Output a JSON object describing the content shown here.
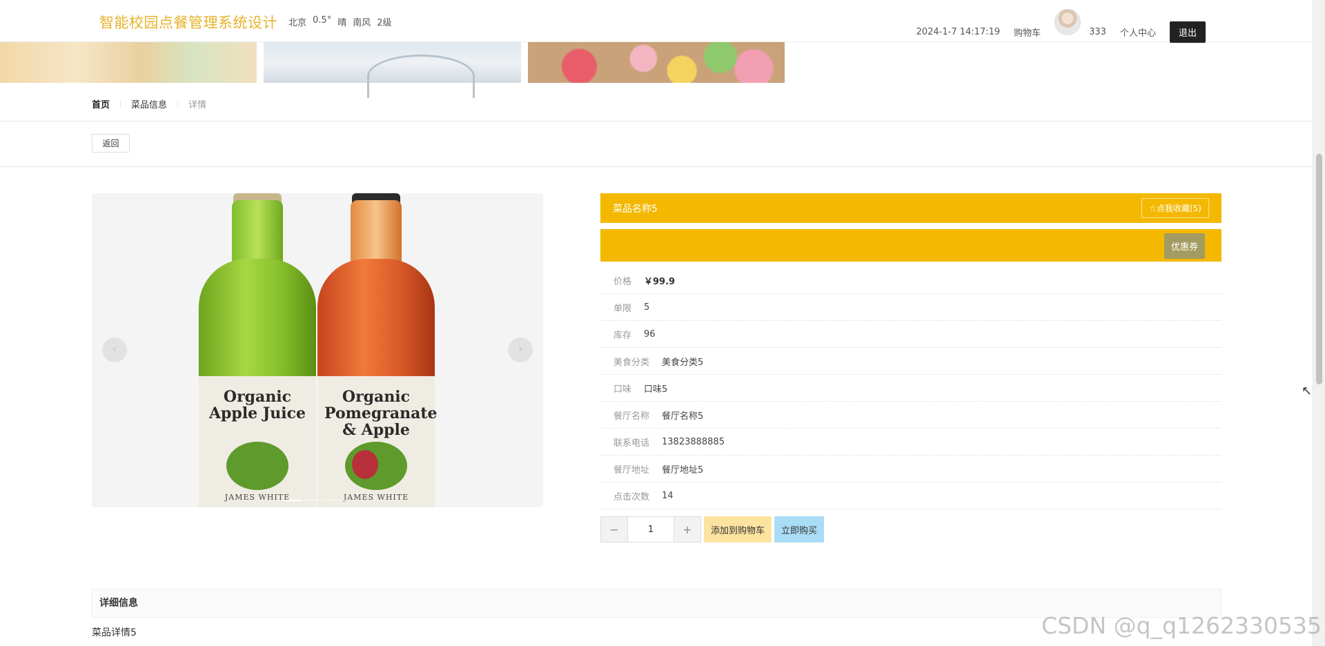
{
  "header": {
    "site_title": "智能校园点餐管理系统设计",
    "weather": {
      "city": "北京",
      "temp": "0.5°",
      "condition": "晴",
      "wind": "南风",
      "level": "2级"
    },
    "datetime": "2024-1-7 14:17:19",
    "cart_label": "购物车",
    "username": "333",
    "profile_label": "个人中心",
    "logout_label": "退出"
  },
  "breadcrumb": {
    "home": "首页",
    "section": "菜品信息",
    "current": "详情"
  },
  "back_label": "返回",
  "carousel": {
    "slides": [
      {
        "label_text": "Organic Apple Juice",
        "brand": "JAMES WHITE"
      },
      {
        "label_text": "Organic Pomegranate & Apple",
        "brand": "JAMES WHITE"
      }
    ],
    "active_index": 0,
    "dot_count": 3
  },
  "dish": {
    "name": "菜品名称5",
    "favorite_label": "☆点我收藏(5)",
    "coupon_label": "优惠券",
    "info": [
      {
        "label": "价格",
        "value": "￥99.9"
      },
      {
        "label": "单限",
        "value": "5"
      },
      {
        "label": "库存",
        "value": "96"
      },
      {
        "label": "美食分类",
        "value": "美食分类5"
      },
      {
        "label": "口味",
        "value": "口味5"
      },
      {
        "label": "餐厅名称",
        "value": "餐厅名称5"
      },
      {
        "label": "联系电话",
        "value": "13823888885"
      },
      {
        "label": "餐厅地址",
        "value": "餐厅地址5"
      },
      {
        "label": "点击次数",
        "value": "14"
      }
    ],
    "quantity": "1",
    "minus_label": "−",
    "plus_label": "+",
    "add_cart_label": "添加到购物车",
    "buy_now_label": "立即购买"
  },
  "details": {
    "header": "详细信息",
    "body": "菜品详情5"
  },
  "watermark": "CSDN @q_q1262330535",
  "icons": {
    "prev": "chevron-left-icon",
    "next": "chevron-right-icon",
    "cursor": "mouse-pointer-icon"
  },
  "colors": {
    "accent": "#f4b800",
    "title": "#e7b32b",
    "coupon": "#a39b61",
    "add_cart": "#fde3a0",
    "buy_now": "#a9dcf5"
  }
}
